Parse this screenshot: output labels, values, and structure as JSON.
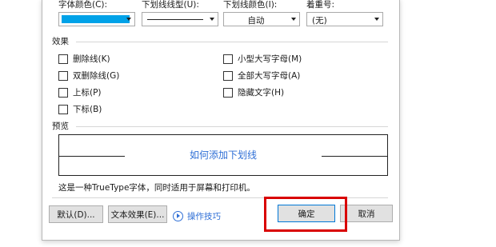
{
  "font_options": {
    "font_color_label": "字体颜色(C):",
    "underline_style_label": "下划线线型(U):",
    "underline_color_label": "下划线颜色(I):",
    "emphasis_label": "着重号:",
    "font_color_value_hex": "#00a2e8",
    "underline_color_value": "自动",
    "emphasis_value": "(无)"
  },
  "effects": {
    "title": "效果",
    "left": [
      "删除线(K)",
      "双删除线(G)",
      "上标(P)",
      "下标(B)"
    ],
    "right": [
      "小型大写字母(M)",
      "全部大写字母(A)",
      "隐藏文字(H)"
    ]
  },
  "preview": {
    "title": "预览",
    "sample_text": "如何添加下划线"
  },
  "note": "这是一种TrueType字体，同时适用于屏幕和打印机。",
  "buttons": {
    "default": "默认(D)...",
    "text_effects": "文本效果(E)...",
    "tips": "操作技巧",
    "ok": "确定",
    "cancel": "取消"
  },
  "colors": {
    "accent_link": "#2f6fd6",
    "highlight_box": "#d90000"
  }
}
